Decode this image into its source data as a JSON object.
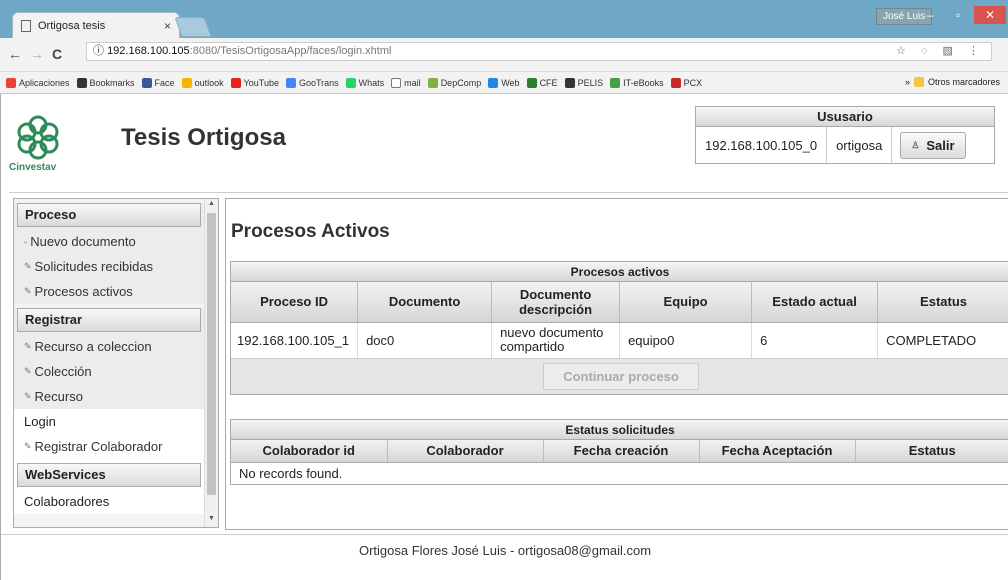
{
  "browser": {
    "tab_title": "Ortigosa tesis",
    "tab_close": "×",
    "user_badge": "José Luis",
    "minimize": "–",
    "maximize": "▫",
    "close": "✕",
    "url_protocol_icon": "ⓘ",
    "url_host": "192.168.100.105",
    "url_path": ":8080/TesisOrtigosaApp/faces/login.xhtml",
    "omnibox_icons": "☆ ◌ ▧ ⋮",
    "nav_icons": {
      "back": "←",
      "forward": "→",
      "reload": "C"
    }
  },
  "bookmarks": [
    {
      "label": "Aplicaciones",
      "icon": "apps-icon",
      "color": "#e94235"
    },
    {
      "label": "Bookmarks",
      "icon": "star-icon",
      "color": "#333333"
    },
    {
      "label": "Face",
      "icon": "facebook-icon",
      "color": "#3b5998"
    },
    {
      "label": "outlook",
      "icon": "outlook-icon",
      "color": "#f4b400"
    },
    {
      "label": "YouTube",
      "icon": "youtube-icon",
      "color": "#e62117"
    },
    {
      "label": "GooTrans",
      "icon": "translate-icon",
      "color": "#4285f4"
    },
    {
      "label": "Whats",
      "icon": "whatsapp-icon",
      "color": "#25d366"
    },
    {
      "label": "mail",
      "icon": "page-icon",
      "color": "#ffffff"
    },
    {
      "label": "DepComp",
      "icon": "gear-icon",
      "color": "#7cb342"
    },
    {
      "label": "Web",
      "icon": "globe-icon",
      "color": "#1e88e5"
    },
    {
      "label": "CFE",
      "icon": "cfe-icon",
      "color": "#2e7d32"
    },
    {
      "label": "PELIS",
      "icon": "movie-icon",
      "color": "#333333"
    },
    {
      "label": "IT-eBooks",
      "icon": "ebook-icon",
      "color": "#43a047"
    },
    {
      "label": "PCX",
      "icon": "pcx-icon",
      "color": "#c62828"
    }
  ],
  "bookmarks_overflow": "»",
  "bookmarks_other": "Otros marcadores",
  "header": {
    "logo_text": "Cinvestav",
    "site_title": "Tesis Ortigosa",
    "user_box": {
      "title": "Ususario",
      "ip": "192.168.100.105_0",
      "username": "ortigosa",
      "logout_label": "Salir"
    }
  },
  "sidebar": {
    "groups": [
      {
        "title": "Proceso",
        "items": [
          "Nuevo documento",
          "Solicitudes recibidas",
          "Procesos activos"
        ]
      },
      {
        "title": "Registrar",
        "items": [
          "Recurso a coleccion",
          "Colección",
          "Recurso"
        ]
      }
    ],
    "login": "Login",
    "registrar_colaborador": "Registrar Colaborador",
    "webservices": "WebServices",
    "colaboradores": "Colaboradores"
  },
  "main": {
    "title": "Procesos Activos",
    "procesos_table": {
      "caption": "Procesos activos",
      "columns": [
        "Proceso ID",
        "Documento",
        "Documento descripción",
        "Equipo",
        "Estado actual",
        "Estatus"
      ],
      "rows": [
        [
          "192.168.100.105_1",
          "doc0",
          "nuevo documento compartido",
          "equipo0",
          "6",
          "COMPLETADO"
        ]
      ],
      "continue_button": "Continuar proceso"
    },
    "solicitudes_table": {
      "caption": "Estatus solicitudes",
      "columns": [
        "Colaborador id",
        "Colaborador",
        "Fecha creación",
        "Fecha Aceptación",
        "Estatus"
      ],
      "empty_message": "No records found."
    }
  },
  "footer": {
    "text": "Ortigosa Flores José Luis - ortigosa08@gmail.com"
  }
}
